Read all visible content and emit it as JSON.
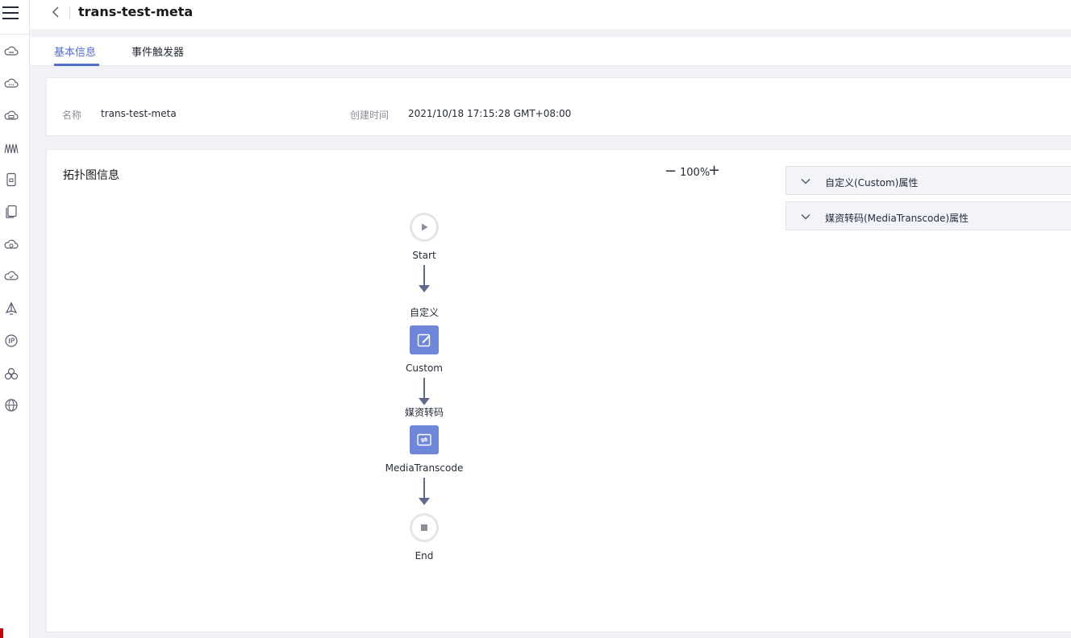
{
  "header": {
    "title": "trans-test-meta",
    "back_icon": "chevron-left-icon"
  },
  "tabs": [
    {
      "label": "基本信息",
      "active": true
    },
    {
      "label": "事件触发器",
      "active": false
    }
  ],
  "info": {
    "name_label": "名称",
    "name_value": "trans-test-meta",
    "created_label": "创建时间",
    "created_value": "2021/10/18 17:15:28 GMT+08:00"
  },
  "topology": {
    "title": "拓扑图信息",
    "zoom_minus": "−",
    "zoom": "100%",
    "zoom_plus": "+",
    "nodes": {
      "start": "Start",
      "custom_top": "自定义",
      "custom": "Custom",
      "transcode_top": "媒资转码",
      "transcode": "MediaTranscode",
      "end": "End"
    }
  },
  "panels": [
    {
      "label": "自定义(Custom)属性",
      "icon": "chevron-down-icon"
    },
    {
      "label": "媒资转码(MediaTranscode)属性",
      "icon": "chevron-down-icon"
    }
  ],
  "sidebar": {
    "icons": [
      "cloud-icon",
      "cloud-dots-icon",
      "cloud-server-icon",
      "waves-icon",
      "document-lock-icon",
      "document-copy-icon",
      "cloud-sync-icon",
      "cloud-check-icon",
      "sail-icon",
      "ip-icon",
      "cluster-icon",
      "globe-icon"
    ]
  },
  "colors": {
    "accent": "#526ecc",
    "node": "#6f87da",
    "arrow": "#5e6b8a",
    "brand_red": "#c7000b"
  }
}
